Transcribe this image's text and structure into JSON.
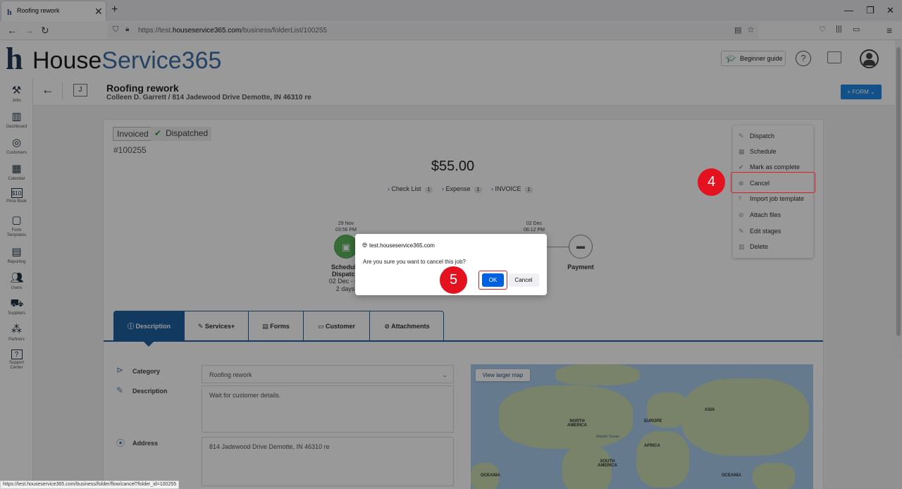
{
  "browser": {
    "tab_title": "Roofing rework",
    "tab_favicon": "h-favicon-icon",
    "url_prefix": "https://test.",
    "url_domain": "houseservice365.com",
    "url_path": "/business/folderList/100255",
    "status_url": "https://test.houseservice365.com/business/folder/flow/cancel?folder_id=100255"
  },
  "header": {
    "logo_part1": "House",
    "logo_part2": "Service365",
    "beginner_guide": "Beginner guide",
    "help": "?"
  },
  "sidebar": {
    "items": [
      {
        "label": "Jobs"
      },
      {
        "label": "Dashboard"
      },
      {
        "label": "Customers"
      },
      {
        "label": "Calendar"
      },
      {
        "label": "Price Book"
      },
      {
        "label": "Form",
        "label2": "Templates"
      },
      {
        "label": "Reporting"
      },
      {
        "label": "Users"
      },
      {
        "label": "Suppliers"
      },
      {
        "label": "Partners"
      },
      {
        "label": "Support",
        "label2": "Center"
      }
    ]
  },
  "job": {
    "badge": "J",
    "title": "Roofing rework",
    "subtitle": "Colleen D. Garrett / 814 Jadewood Drive Demotte, IN 46310 re",
    "form_button": "+ FORM ⌄",
    "status_invoiced": "Invoiced",
    "status_dispatched": "Dispatched",
    "number": "#100255",
    "price": "$55.00",
    "pills": [
      {
        "label": "Check List",
        "count": "1"
      },
      {
        "label": "Expense",
        "count": "1"
      },
      {
        "label": "INVOICE",
        "count": "1"
      }
    ],
    "stage1": {
      "date": "29 Nov",
      "time": "03:56 PM",
      "label1": "Schedule",
      "label2": "Dispatch",
      "range": "02 Dec - 03",
      "days": "2 days"
    },
    "stage3": {
      "date": "02 Dec",
      "time": "06:12 PM",
      "label": "Payment"
    }
  },
  "menu": {
    "items": [
      {
        "label": "Dispatch"
      },
      {
        "label": "Schedule"
      },
      {
        "label": "Mark as complete"
      },
      {
        "label": "Cancel"
      },
      {
        "label": "Import job template"
      },
      {
        "label": "Attach files"
      },
      {
        "label": "Edit stages"
      },
      {
        "label": "Delete"
      }
    ]
  },
  "annotations": {
    "step4": "4",
    "step5": "5"
  },
  "tabs": [
    {
      "label": "Description"
    },
    {
      "label": "Services+"
    },
    {
      "label": "Forms"
    },
    {
      "label": "Customer"
    },
    {
      "label": "Attachments"
    }
  ],
  "form": {
    "category_label": "Category",
    "category_value": "Roofing rework",
    "description_label": "Description",
    "description_value": "Wait for customer details.",
    "address_label": "Address",
    "address_value": "814 Jadewood Drive Demotte, IN 46310 re"
  },
  "map": {
    "button": "View larger map",
    "labels": [
      "NORTH AMERICA",
      "EUROPE",
      "ASIA",
      "AFRICA",
      "SOUTH AMERICA",
      "OCEANIA",
      "OCEANIA",
      "Atlantic Ocean"
    ]
  },
  "dialog": {
    "host": "test.houseservice365.com",
    "message": "Are you sure you want to cancel this job?",
    "ok": "OK",
    "cancel": "Cancel"
  }
}
